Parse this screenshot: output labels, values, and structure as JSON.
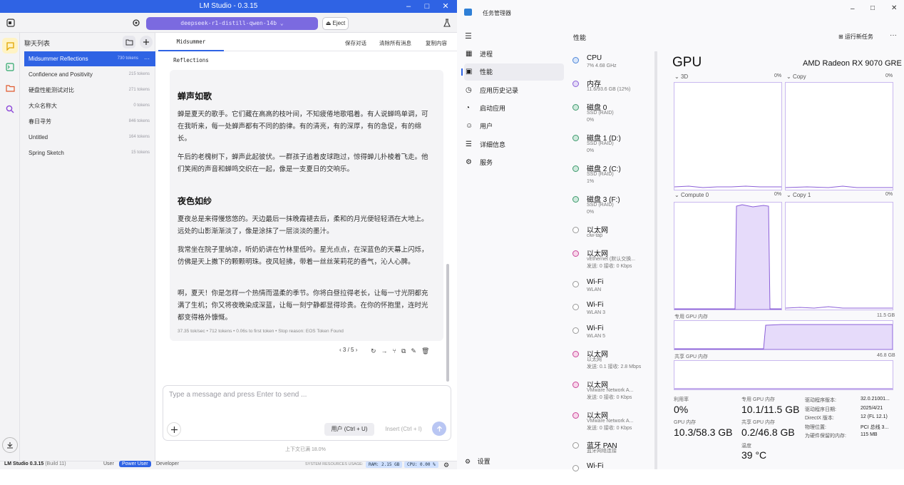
{
  "lm": {
    "title": "LM Studio - 0.3.15",
    "model": "deepseek-r1-distill-qwen-14b",
    "eject": "Eject",
    "chats_header": "聊天列表",
    "chats": [
      {
        "name": "Midsummer Reflections",
        "tokens": "730 tokens",
        "selected": true
      },
      {
        "name": "Confidence and Positivity",
        "tokens": "215 tokens"
      },
      {
        "name": "硬盘性能测试对比",
        "tokens": "271 tokens"
      },
      {
        "name": "大众名称大",
        "tokens": "0 tokens"
      },
      {
        "name": "春日寻芳",
        "tokens": "846 tokens"
      },
      {
        "name": "Untitled",
        "tokens": "164 tokens"
      },
      {
        "name": "Spring Sketch",
        "tokens": "15 tokens"
      }
    ],
    "tab": "Midsummer Reflections",
    "actions": [
      "保存对话",
      "清除所有消息",
      "复制内容"
    ],
    "message": {
      "h1": "蝉声如歌",
      "p1": "蝉是夏天的歌手。它们藏在高高的枝叶间，不知疲倦地歌唱着。有人说蝉鸣单调，可在我听来，每一处蝉声都有不同的韵律。有的清亮，有的深厚，有的急促，有的绵长。",
      "p2": "午后的老槐树下，蝉声此起彼伏。一群孩子追着皮球跑过，惊得蝉儿扑棱着飞走。他们笑闹的声音和蝉鸣交织在一起，像是一支夏日的交响乐。",
      "h2": "夜色如纱",
      "p3": "夏夜总是来得慢悠悠的。天边最后一抹晚霞褪去后，柔和的月光便轻轻洒在大地上。远处的山影渐渐淡了，像是涂抹了一层淡淡的墨汁。",
      "p4": "我常坐在院子里纳凉，听奶奶讲在竹林里低吟。星光点点，在深蓝色的天幕上闪烁，仿佛是天上撒下的颗颗明珠。夜风轻拂，带着一丝丝茉莉花的香气，沁人心脾。",
      "p5": "啊，夏天！你是怎样一个热情而温柔的季节。你将白昼拉得老长，让每一寸光阴都充满了生机；你又将夜晚染成深蓝，让每一刻宁静都显得珍贵。在你的怀抱里，连时光都变得格外慷慨。",
      "stats": "37.35 tok/sec • 712 tokens • 0.06s to first token • Stop reason: EOS Token Found",
      "pager": "3 / 5"
    },
    "input_placeholder": "Type a message and press Enter to send ...",
    "user_btn": "用户 (Ctrl + U)",
    "insert_btn": "Insert (Ctrl + I)",
    "context": "上下文已满 18.0%",
    "status": {
      "app": "LM Studio 0.3.15",
      "build": "(Build 11)",
      "modes": [
        "User",
        "Power User",
        "Developer"
      ],
      "res_label": "SYSTEM RESOURCES USAGE:",
      "ram": "RAM: 2.15 GB",
      "cpu": "CPU: 0.00 %"
    }
  },
  "tm": {
    "title": "任务管理器",
    "page": "性能",
    "run_task": "运行新任务",
    "nav": [
      "进程",
      "性能",
      "应用历史记录",
      "启动应用",
      "用户",
      "详细信息",
      "服务"
    ],
    "settings": "设置",
    "devices": [
      {
        "name": "CPU",
        "sub": [
          "7%  4.68 GHz"
        ]
      },
      {
        "name": "内存",
        "sub": [
          "11.6/93.6 GB (12%)"
        ]
      },
      {
        "name": "磁盘 0",
        "sub": [
          "SSD (RAID)",
          "0%"
        ]
      },
      {
        "name": "磁盘 1 (D:)",
        "sub": [
          "SSD (RAID)",
          "0%"
        ]
      },
      {
        "name": "磁盘 2 (C:)",
        "sub": [
          "SSD (RAID)",
          "1%"
        ]
      },
      {
        "name": "磁盘 3 (F:)",
        "sub": [
          "SSD (RAID)",
          "0%"
        ]
      },
      {
        "name": "以太网",
        "sub": [
          "clw-tap"
        ]
      },
      {
        "name": "以太网",
        "sub": [
          "vEthernet (默认交换...",
          "发送: 0 接收: 0 Kbps"
        ]
      },
      {
        "name": "Wi-Fi",
        "sub": [
          "WLAN"
        ]
      },
      {
        "name": "Wi-Fi",
        "sub": [
          "WLAN 3"
        ]
      },
      {
        "name": "Wi-Fi",
        "sub": [
          "WLAN 5"
        ]
      },
      {
        "name": "以太网",
        "sub": [
          "以太网",
          "发送: 0.1  接收: 2.8 Mbps"
        ]
      },
      {
        "name": "以太网",
        "sub": [
          "VMware Network A...",
          "发送: 0 接收: 0 Kbps"
        ]
      },
      {
        "name": "以太网",
        "sub": [
          "VMware Network A...",
          "发送: 0 接收: 0 Kbps"
        ]
      },
      {
        "name": "蓝牙 PAN",
        "sub": [
          "蓝牙网络连接"
        ]
      },
      {
        "name": "Wi-Fi",
        "sub": [
          ""
        ]
      }
    ],
    "gpu_title": "GPU",
    "gpu_name": "AMD Radeon RX 9070 GRE",
    "graphs": {
      "g1": "3D",
      "g2": "Copy",
      "g3": "Compute 0",
      "g4": "Copy 1",
      "pct0": "0%",
      "pct1": "0%",
      "pct2": "0%",
      "pct3": "0%"
    },
    "dedicated_label": "专用 GPU 内存",
    "dedicated_max": "11.5 GB",
    "shared_label": "共享 GPU 内存",
    "shared_max": "46.8 GB",
    "stats": {
      "util_l": "利用率",
      "util_v": "0%",
      "ded_l": "专用 GPU 内存",
      "ded_v": "10.1/11.5 GB",
      "gpu_mem_l": "GPU 内存",
      "gpu_mem_v": "10.3/58.3 GB",
      "sh_l": "共享 GPU 内存",
      "sh_v": "0.2/46.8 GB",
      "temp_l": "温度",
      "temp_v": "39 °C"
    },
    "info": [
      [
        "驱动程序版本:",
        "32.0.21001..."
      ],
      [
        "驱动程序日期:",
        "2025/4/21"
      ],
      [
        "DirectX 版本:",
        "12 (FL 12.1)"
      ],
      [
        "物理位置:",
        "PCI 总线 3..."
      ],
      [
        "为硬件保留的内存:",
        "115 MB"
      ]
    ],
    "colors": {
      "accent": "#8b5fd8",
      "fill": "#e6dbfa"
    }
  }
}
